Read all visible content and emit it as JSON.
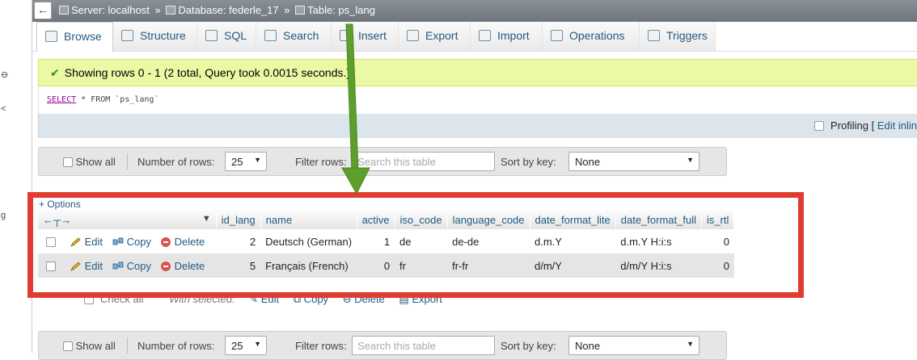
{
  "breadcrumb": {
    "server_label": "Server: localhost",
    "database_label": "Database: federle_17",
    "table_label": "Table: ps_lang",
    "separator": "»"
  },
  "tabs": [
    {
      "label": "Browse",
      "icon": "browse-icon",
      "active": true
    },
    {
      "label": "Structure",
      "icon": "structure-icon"
    },
    {
      "label": "SQL",
      "icon": "sql-icon"
    },
    {
      "label": "Search",
      "icon": "search-icon"
    },
    {
      "label": "Insert",
      "icon": "insert-icon"
    },
    {
      "label": "Export",
      "icon": "export-icon"
    },
    {
      "label": "Import",
      "icon": "import-icon"
    },
    {
      "label": "Operations",
      "icon": "wrench-icon"
    },
    {
      "label": "Triggers",
      "icon": "triggers-icon"
    }
  ],
  "message": {
    "text": "Showing rows 0 - 1 (2 total, Query took 0.0015 seconds.)"
  },
  "sql": {
    "keyword": "SELECT",
    "rest": " * FROM `ps_lang`"
  },
  "profiling": {
    "label": "Profiling [",
    "edit_inline": "Edit inlin"
  },
  "navbar": {
    "show_all": "Show all",
    "number_of_rows": "Number of rows:",
    "rows_value": "25",
    "filter_rows": "Filter rows:",
    "search_placeholder": "Search this table",
    "sort_by_key": "Sort by key:",
    "sort_value": "None"
  },
  "options_link": "+ Options",
  "table": {
    "columns": [
      "id_lang",
      "name",
      "active",
      "iso_code",
      "language_code",
      "date_format_lite",
      "date_format_full",
      "is_rtl"
    ],
    "actions": {
      "edit": "Edit",
      "copy": "Copy",
      "delete": "Delete"
    },
    "rows": [
      {
        "id_lang": "2",
        "name": "Deutsch (German)",
        "active": "1",
        "iso_code": "de",
        "language_code": "de-de",
        "date_format_lite": "d.m.Y",
        "date_format_full": "d.m.Y H:i:s",
        "is_rtl": "0"
      },
      {
        "id_lang": "5",
        "name": "Français (French)",
        "active": "0",
        "iso_code": "fr",
        "language_code": "fr-fr",
        "date_format_lite": "d/m/Y",
        "date_format_full": "d/m/Y H:i:s",
        "is_rtl": "0"
      }
    ]
  },
  "bulk": {
    "check_all": "Check all",
    "with_selected": "With selected:",
    "edit": "Edit",
    "copy": "Copy",
    "delete": "Delete",
    "export": "Export"
  },
  "colors": {
    "annotation_box": "#e03c31",
    "annotation_arrow": "#5e9e2d",
    "success_bg": "#ebf8a4",
    "link": "#235a81"
  }
}
